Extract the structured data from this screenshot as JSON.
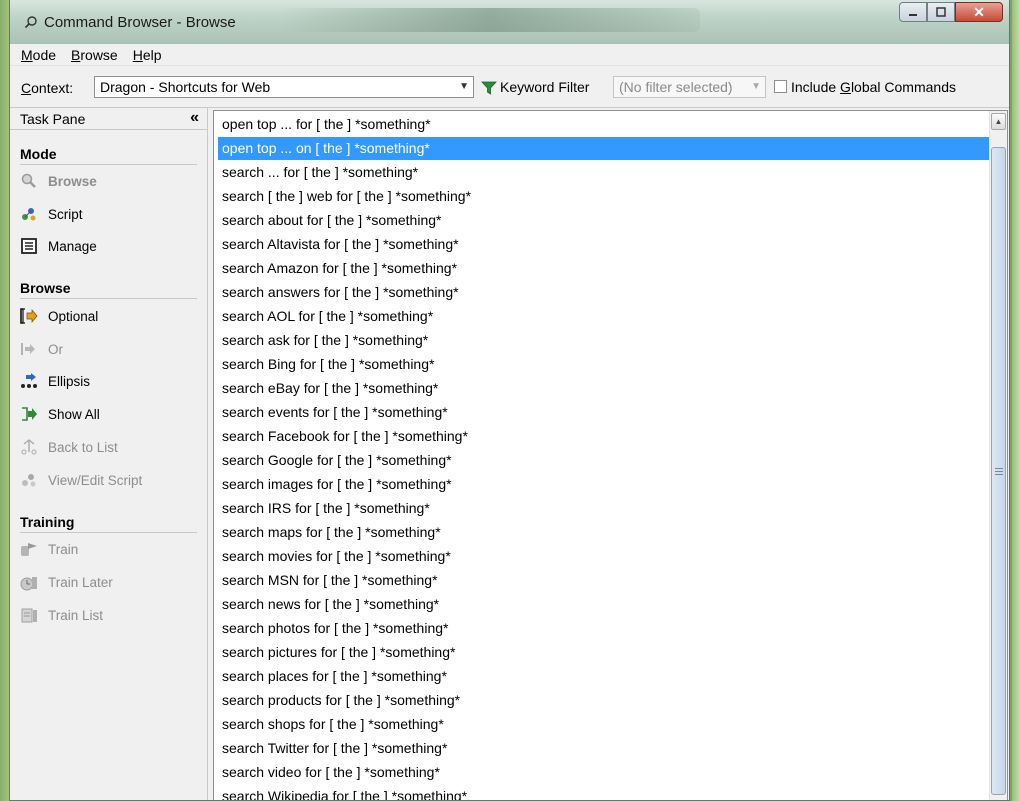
{
  "window": {
    "title": "Command Browser - Browse"
  },
  "menubar": {
    "items": [
      {
        "label": "Mode",
        "accel": "M",
        "rest": "ode"
      },
      {
        "label": "Browse",
        "accel": "B",
        "rest": "rowse"
      },
      {
        "label": "Help",
        "accel": "H",
        "rest": "elp"
      }
    ]
  },
  "toolbar": {
    "context_label": "Context:",
    "context_accel": "C",
    "context_rest": "ontext:",
    "context_value": "Dragon - Shortcuts for Web",
    "keyword_filter_label": "Keyword Filter",
    "filter_value": "(No filter selected)",
    "include_global_label": "Include Global Commands",
    "include_global_pre": "Include ",
    "include_global_accel": "G",
    "include_global_post": "lobal Commands",
    "include_global_checked": false
  },
  "taskpane": {
    "title": "Task Pane",
    "collapse_glyph": "«",
    "sections": {
      "mode": "Mode",
      "browse": "Browse",
      "training": "Training"
    },
    "mode_items": [
      "Browse",
      "Script",
      "Manage"
    ],
    "browse_items": [
      "Optional",
      "Or",
      "Ellipsis",
      "Show All",
      "Back to List",
      "View/Edit Script"
    ],
    "training_items": [
      "Train",
      "Train Later",
      "Train List"
    ]
  },
  "commands": {
    "selected_index": 1,
    "items": [
      "open top ... for [ the ] *something*",
      "open top ... on [ the ] *something*",
      "search ... for [ the ] *something*",
      "search [ the ] web for [ the ] *something*",
      "search about for [ the ] *something*",
      "search Altavista for [ the ] *something*",
      "search Amazon for [ the ] *something*",
      "search answers for [ the ] *something*",
      "search AOL for [ the ] *something*",
      "search ask for [ the ] *something*",
      "search Bing for [ the ] *something*",
      "search eBay for [ the ] *something*",
      "search events for [ the ] *something*",
      "search Facebook for [ the ] *something*",
      "search Google for [ the ] *something*",
      "search images for [ the ] *something*",
      "search IRS for [ the ] *something*",
      "search maps for [ the ] *something*",
      "search movies for [ the ] *something*",
      "search MSN for [ the ] *something*",
      "search news for [ the ] *something*",
      "search photos for [ the ] *something*",
      "search pictures for [ the ] *something*",
      "search places for [ the ] *something*",
      "search products for [ the ] *something*",
      "search shops for [ the ] *something*",
      "search Twitter for [ the ] *something*",
      "search video for [ the ] *something*",
      "search Wikipedia for [ the ] *something*"
    ]
  },
  "colors": {
    "selection": "#3399ff",
    "disabled_text": "#8d8d8d"
  }
}
